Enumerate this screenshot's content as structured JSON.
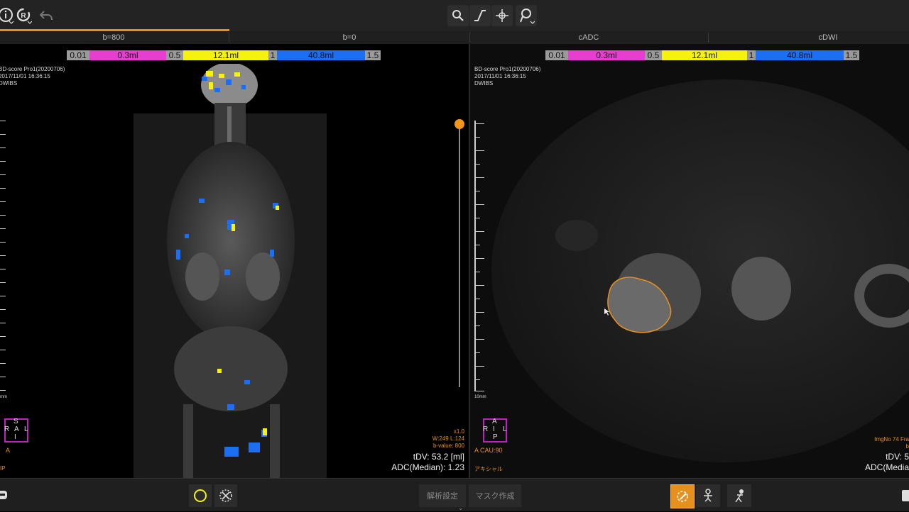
{
  "toolbar": {
    "left_icons": [
      "info-icon",
      "rotate-icon",
      "undo-icon"
    ],
    "center_icons": [
      "zoom-icon",
      "window-level-icon",
      "pan-icon",
      "roi-pin-icon"
    ]
  },
  "tabs": [
    "b=800",
    "b=0",
    "cADC",
    "cDWI"
  ],
  "colorbar": {
    "segments": [
      {
        "label": "0.01",
        "color": "grey"
      },
      {
        "label": "0.3ml",
        "color": "magenta"
      },
      {
        "label": "0.5",
        "color": "grey"
      },
      {
        "label": "12.1ml",
        "color": "yellow"
      },
      {
        "label": "1",
        "color": "grey"
      },
      {
        "label": "40.8ml",
        "color": "blue"
      },
      {
        "label": "1.5",
        "color": "grey"
      }
    ]
  },
  "left_view": {
    "info": [
      "BD-score Pro1(20200706)",
      "2017/11/01 16:36:15",
      "DWIBS"
    ],
    "ruler_label": "mm",
    "orientation": {
      "top": "S",
      "left": "R",
      "right": "L",
      "bottom": "I",
      "below": "A",
      "corner": "IP"
    },
    "stats_orange": [
      "x1.0",
      "W:249 L:124",
      "b-value: 800"
    ],
    "tdv": "tDV: 53.2 [ml]",
    "adc": "ADC(Median): 1.23"
  },
  "right_view": {
    "info": [
      "BD-score Pro1(20200706)",
      "2017/11/01 16:36:15",
      "DWIBS"
    ],
    "ruler_label": "10mm",
    "orientation": {
      "top": "A",
      "left": "R",
      "center": "I",
      "right": "L",
      "bottom": "P",
      "below": "A CAU:90",
      "corner": "アキシャル"
    },
    "stats_orange": [
      "ImgNo 74 Fra",
      "b"
    ],
    "tdv": "tDV: 5",
    "adc": "ADC(Media"
  },
  "bottom": {
    "analysis_settings": "解析設定",
    "mask_create": "マスク作成"
  },
  "colors": {
    "accent": "#e8901c",
    "magenta": "#e83ecf",
    "yellow": "#f4f20e",
    "blue": "#1c6ef2"
  }
}
